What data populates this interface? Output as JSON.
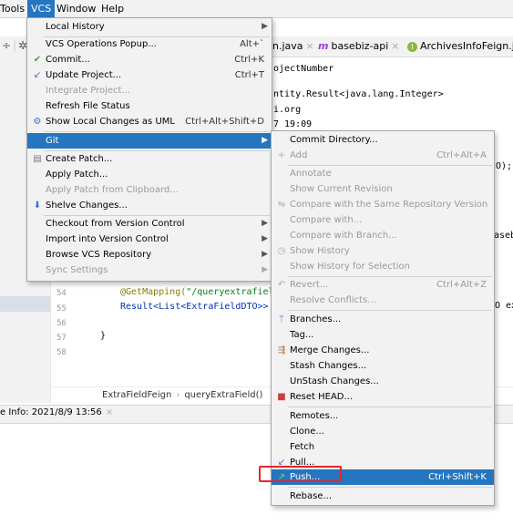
{
  "menubar": {
    "items": [
      "Tools",
      "VCS",
      "Window",
      "Help"
    ],
    "active": "VCS"
  },
  "tabs": [
    {
      "label": "n.java"
    },
    {
      "label": "basebiz-api"
    },
    {
      "label": "ArchivesInfoFeign.java"
    }
  ],
  "code_peek": {
    "l1": "ojectNumber",
    "l2": "ntity.Result<java.lang.Integer>",
    "l3": "i.org",
    "l4": "7 19:09",
    "l5": "O);",
    "l6": "aseb",
    "l7": "O ex"
  },
  "editor": {
    "lines": [
      {
        "no": "54",
        "text_a": "@GetMapping(",
        "text_b": "\"/queryextrafield"
      },
      {
        "no": "55",
        "text_a": "Result<List<ExtraFieldDTO>> q"
      },
      {
        "no": "56"
      },
      {
        "no": "57",
        "text_a": "}"
      },
      {
        "no": "58"
      }
    ]
  },
  "breadcrumb": [
    "ExtraFieldFeign",
    "queryExtraField()"
  ],
  "status": {
    "text": "e Info: 2021/8/9 13:56"
  },
  "vcs_menu": {
    "items": [
      {
        "label": "Local History",
        "shortcut": "",
        "submenu": true
      },
      {
        "label": "VCS Operations Popup...",
        "shortcut": "Alt+`"
      },
      {
        "label": "Commit...",
        "shortcut": "Ctrl+K",
        "icon": "commit-icon"
      },
      {
        "label": "Update Project...",
        "shortcut": "Ctrl+T",
        "icon": "update-icon"
      },
      {
        "label": "Integrate Project...",
        "disabled": true
      },
      {
        "label": "Refresh File Status"
      },
      {
        "label": "Show Local Changes as UML",
        "shortcut": "Ctrl+Alt+Shift+D",
        "icon": "uml-icon"
      },
      {
        "label": "Git",
        "submenu": true,
        "selected": true
      },
      {
        "label": "Create Patch...",
        "icon": "patch-icon"
      },
      {
        "label": "Apply Patch..."
      },
      {
        "label": "Apply Patch from Clipboard...",
        "disabled": true
      },
      {
        "label": "Shelve Changes...",
        "icon": "shelve-icon"
      },
      {
        "label": "Checkout from Version Control",
        "submenu": true
      },
      {
        "label": "Import into Version Control",
        "submenu": true
      },
      {
        "label": "Browse VCS Repository",
        "submenu": true
      },
      {
        "label": "Sync Settings",
        "submenu": true,
        "disabled": true
      }
    ]
  },
  "git_menu": {
    "items": [
      {
        "label": "Commit Directory..."
      },
      {
        "label": "Add",
        "shortcut": "Ctrl+Alt+A",
        "disabled": true,
        "icon": "plus-icon"
      },
      {
        "label": "Annotate",
        "disabled": true
      },
      {
        "label": "Show Current Revision",
        "disabled": true
      },
      {
        "label": "Compare with the Same Repository Version",
        "disabled": true,
        "icon": "compare-icon"
      },
      {
        "label": "Compare with...",
        "disabled": true
      },
      {
        "label": "Compare with Branch...",
        "disabled": true
      },
      {
        "label": "Show History",
        "disabled": true,
        "icon": "history-icon"
      },
      {
        "label": "Show History for Selection",
        "disabled": true
      },
      {
        "label": "Revert...",
        "shortcut": "Ctrl+Alt+Z",
        "disabled": true,
        "icon": "revert-icon"
      },
      {
        "label": "Resolve Conflicts...",
        "disabled": true
      },
      {
        "label": "Branches...",
        "icon": "branch-icon"
      },
      {
        "label": "Tag..."
      },
      {
        "label": "Merge Changes...",
        "icon": "merge-icon"
      },
      {
        "label": "Stash Changes..."
      },
      {
        "label": "UnStash Changes..."
      },
      {
        "label": "Reset HEAD...",
        "icon": "reset-icon"
      },
      {
        "label": "Remotes..."
      },
      {
        "label": "Clone..."
      },
      {
        "label": "Fetch"
      },
      {
        "label": "Pull...",
        "icon": "pull-icon"
      },
      {
        "label": "Push...",
        "shortcut": "Ctrl+Shift+K",
        "selected": true,
        "icon": "push-icon"
      },
      {
        "label": "Rebase..."
      }
    ]
  },
  "colors": {
    "selection": "#2675bf",
    "menu_bg": "#f2f2f2",
    "highlight_box": "#e3262c"
  }
}
